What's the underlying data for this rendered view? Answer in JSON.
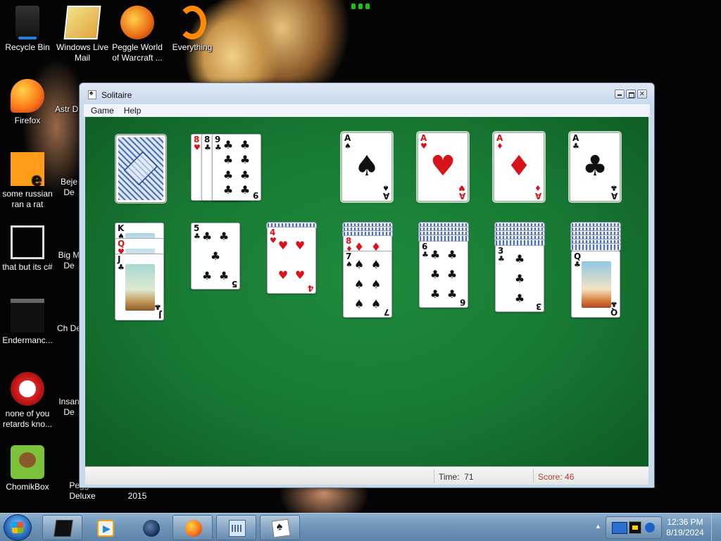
{
  "desktop": {
    "icons": [
      {
        "label": "Recycle Bin"
      },
      {
        "label": "Windows Live Mail"
      },
      {
        "label": "Peggle World of Warcraft ..."
      },
      {
        "label": "Everything"
      },
      {
        "label": "Firefox"
      },
      {
        "label": "Astr De"
      },
      {
        "label": "some russian ran a rat"
      },
      {
        "label": "Beje De"
      },
      {
        "label": "that but its c#"
      },
      {
        "label": "Big M De"
      },
      {
        "label": "Endermanc..."
      },
      {
        "label": "Ch De"
      },
      {
        "label": "none of you retards kno..."
      },
      {
        "label": "Insan De"
      },
      {
        "label": "ChomikBox"
      },
      {
        "label": "Peggle Deluxe"
      },
      {
        "label": "2015"
      }
    ]
  },
  "window": {
    "title": "Solitaire",
    "menu": [
      "Game",
      "Help"
    ],
    "status": {
      "time_label": "Time:",
      "time_value": "71",
      "score_label": "Score:",
      "score_value": "46"
    }
  },
  "game": {
    "waste": [
      {
        "rank": "8",
        "suit": "♥",
        "color": "red"
      },
      {
        "rank": "8",
        "suit": "♣",
        "color": "black"
      },
      {
        "rank": "9",
        "suit": "♣",
        "color": "black"
      }
    ],
    "foundations": [
      {
        "rank": "A",
        "suit": "♠",
        "color": "black"
      },
      {
        "rank": "A",
        "suit": "♥",
        "color": "red"
      },
      {
        "rank": "A",
        "suit": "♦",
        "color": "red"
      },
      {
        "rank": "A",
        "suit": "♣",
        "color": "black"
      }
    ],
    "tableau": [
      {
        "face_up": [
          {
            "rank": "K",
            "suit": "♠",
            "color": "black"
          },
          {
            "rank": "Q",
            "suit": "♥",
            "color": "red"
          },
          {
            "rank": "J",
            "suit": "♣",
            "color": "black"
          }
        ]
      },
      {
        "face_up": [
          {
            "rank": "5",
            "suit": "♣",
            "color": "black"
          }
        ]
      },
      {
        "face_up": [
          {
            "rank": "4",
            "suit": "♥",
            "color": "red"
          }
        ]
      },
      {
        "face_up": [
          {
            "rank": "8",
            "suit": "♦",
            "color": "red"
          },
          {
            "rank": "7",
            "suit": "♠",
            "color": "black"
          }
        ]
      },
      {
        "face_up": [
          {
            "rank": "6",
            "suit": "♣",
            "color": "black"
          }
        ]
      },
      {
        "face_up": [
          {
            "rank": "3",
            "suit": "♣",
            "color": "black"
          }
        ]
      },
      {
        "face_up": [
          {
            "rank": "Q",
            "suit": "♣",
            "color": "black"
          }
        ]
      }
    ]
  },
  "taskbar": {
    "clock_time": "12:36 PM",
    "clock_date": "8/19/2024",
    "buttons": [
      "cube-app",
      "media-player",
      "globe-app",
      "firefox",
      "keyboard-app",
      "solitaire"
    ]
  },
  "colors": {
    "felt": "#187a33",
    "red_suit": "#d8141b",
    "taskbar": "#6f95b9"
  }
}
